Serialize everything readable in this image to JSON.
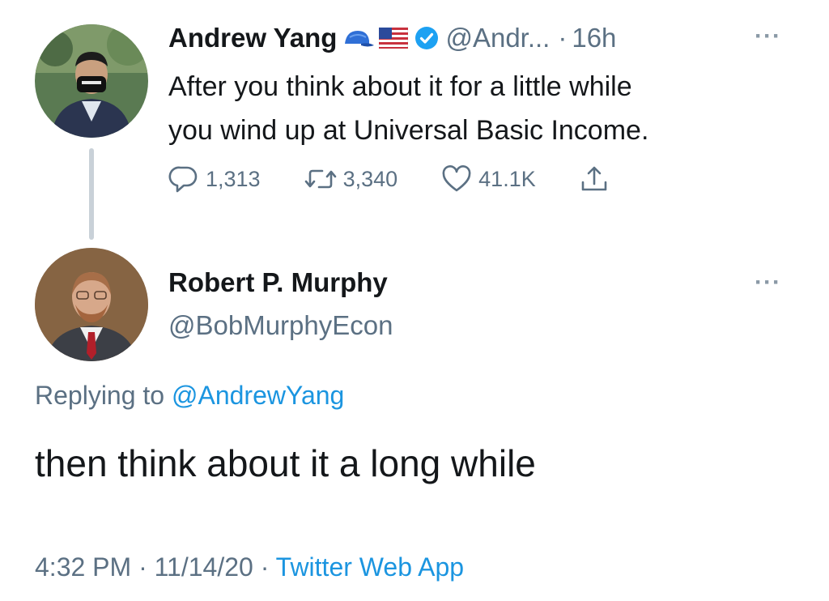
{
  "tweet": {
    "author_name": "Andrew Yang",
    "author_handle": "@Andr...",
    "separator": "·",
    "time": "16h",
    "more": "···",
    "text_line1": "After you think about it for a little while",
    "text_line2": "you wind up at Universal Basic Income.",
    "emojis": [
      "blue-cap-icon",
      "us-flag-icon"
    ],
    "actions": {
      "replies": "1,313",
      "retweets": "3,340",
      "likes": "41.1K"
    }
  },
  "reply": {
    "author_name": "Robert P. Murphy",
    "author_handle": "@BobMurphyEcon",
    "more": "···",
    "replying_prefix": "Replying to ",
    "replying_mention": "@AndrewYang",
    "text": "then think about it a long while",
    "timestamp_time": "4:32 PM",
    "meta_sep": " · ",
    "timestamp_date": "11/14/20",
    "source_app": "Twitter Web App"
  },
  "colors": {
    "text_primary": "#14171a",
    "text_secondary": "#5b7083",
    "link": "#1b95e0",
    "verified": "#1da1f2",
    "thread_line": "#c9d1d8"
  }
}
